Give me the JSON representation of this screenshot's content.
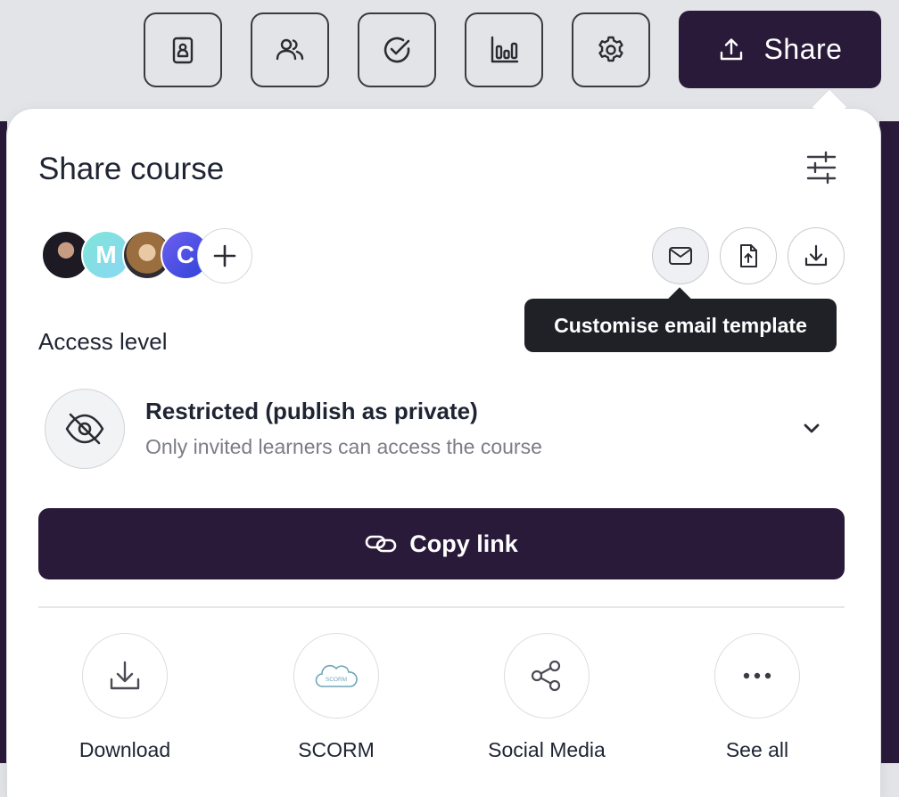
{
  "toolbar": {
    "buttons": [
      {
        "icon": "badge-icon"
      },
      {
        "icon": "users-icon"
      },
      {
        "icon": "check-circle-icon"
      },
      {
        "icon": "bar-chart-icon"
      },
      {
        "icon": "gear-icon"
      }
    ],
    "share_label": "Share"
  },
  "panel": {
    "title": "Share course",
    "avatars": [
      {
        "initial": ""
      },
      {
        "initial": "M"
      },
      {
        "initial": ""
      },
      {
        "initial": "C"
      }
    ],
    "actions": [
      "mail-icon",
      "file-upload-icon",
      "download-icon"
    ],
    "tooltip": "Customise email template",
    "access_level_label": "Access level",
    "access": {
      "title": "Restricted (publish as private)",
      "subtitle": "Only invited learners can access the course"
    },
    "copy_link_label": "Copy link",
    "options": [
      {
        "label": "Download",
        "icon": "download-icon"
      },
      {
        "label": "SCORM",
        "icon": "scorm-cloud-icon",
        "badge": "SCORM"
      },
      {
        "label": "Social Media",
        "icon": "share-nodes-icon"
      },
      {
        "label": "See all",
        "icon": "more-dots-icon"
      }
    ]
  },
  "colors": {
    "brand_dark": "#2a1a3a",
    "tooltip_bg": "#1f2127",
    "toolbar_bg": "#e3e4e7"
  }
}
